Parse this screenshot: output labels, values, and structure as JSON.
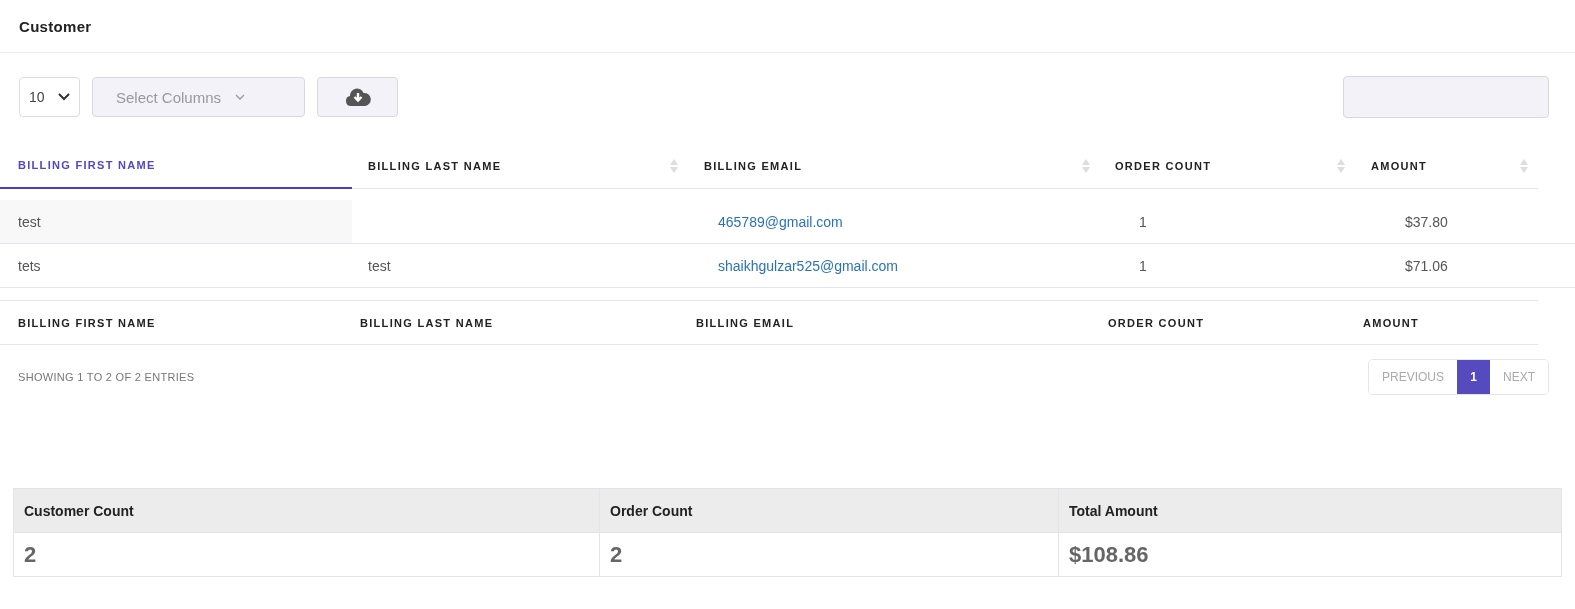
{
  "page_title": "Customer",
  "page_length": {
    "value": "10"
  },
  "column_select": {
    "placeholder": "Select Columns"
  },
  "table": {
    "columns": [
      {
        "label": "BILLING FIRST NAME",
        "sorted": true
      },
      {
        "label": "BILLING LAST NAME",
        "sorted": false
      },
      {
        "label": "BILLING EMAIL",
        "sorted": false
      },
      {
        "label": "ORDER COUNT",
        "sorted": false
      },
      {
        "label": "AMOUNT",
        "sorted": false
      }
    ],
    "rows": [
      [
        "test",
        "",
        "465789@gmail.com",
        "1",
        "$37.80"
      ],
      [
        "tets",
        "test",
        "shaikhgulzar525@gmail.com",
        "1",
        "$71.06"
      ]
    ],
    "footer": [
      "BILLING FIRST NAME",
      "BILLING LAST NAME",
      "BILLING EMAIL",
      "ORDER COUNT",
      "AMOUNT"
    ]
  },
  "info": "SHOWING 1 TO 2 OF 2 ENTRIES",
  "pagination": {
    "previous": "PREVIOUS",
    "pages": [
      {
        "label": "1",
        "selected": true
      }
    ],
    "next": "NEXT"
  },
  "summary": [
    {
      "label": "Customer Count",
      "value": "2"
    },
    {
      "label": "Order Count",
      "value": "2"
    },
    {
      "label": "Total Amount",
      "value": "$108.86"
    }
  ]
}
